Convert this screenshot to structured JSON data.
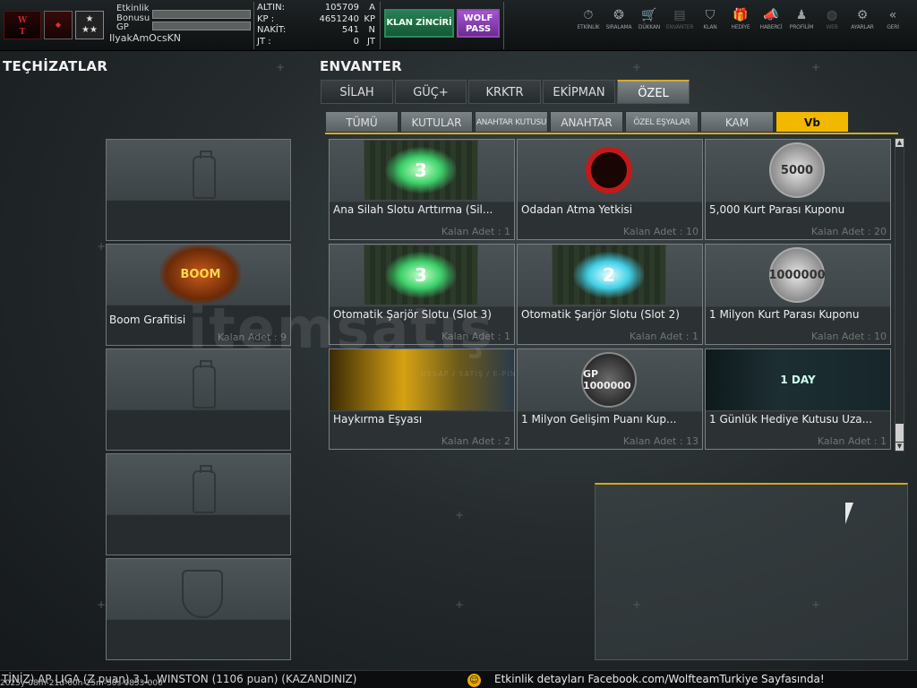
{
  "player": {
    "event_bonus_label": "Etkinlik Bonusu",
    "gp_label": "GP",
    "username": "IlyakAmOcsKN",
    "event_bonus_fraction": 0.0,
    "gp_fraction": 0.0
  },
  "currency": [
    {
      "key": "ALTIN:",
      "value": "105709",
      "unit": "A"
    },
    {
      "key": "KP   :",
      "value": "4651240",
      "unit": "KP"
    },
    {
      "key": "NAKİT:",
      "value": "541",
      "unit": "N"
    },
    {
      "key": "JT   :",
      "value": "0",
      "unit": "JT"
    }
  ],
  "buttons": {
    "clan_chain": "KLAN ZİNCİRİ",
    "wolf_pass": "WOLF PASS"
  },
  "nav": [
    {
      "label": "ETKİNLİK",
      "icon": "stopwatch-icon",
      "glyph": "⏱",
      "enabled": true
    },
    {
      "label": "SIRALAMA",
      "icon": "medal-icon",
      "glyph": "❂",
      "enabled": true
    },
    {
      "label": "DÜKKAN",
      "icon": "cart-icon",
      "glyph": "🛒",
      "enabled": true
    },
    {
      "label": "ENVANTER",
      "icon": "inventory-icon",
      "glyph": "▤",
      "enabled": false
    },
    {
      "label": "KLAN",
      "icon": "clan-shield-icon",
      "glyph": "⛉",
      "enabled": true
    },
    {
      "label": "HEDİYE",
      "icon": "gift-icon",
      "glyph": "🎁",
      "enabled": true
    },
    {
      "label": "HABERCİ",
      "icon": "megaphone-icon",
      "glyph": "📣",
      "enabled": true
    },
    {
      "label": "PROFİLİM",
      "icon": "profile-icon",
      "glyph": "♟",
      "enabled": true
    },
    {
      "label": "WEB",
      "icon": "globe-icon",
      "glyph": "◍",
      "enabled": false
    },
    {
      "label": "AYARLAR",
      "icon": "gear-icon",
      "glyph": "⚙",
      "enabled": true
    },
    {
      "label": "GERİ",
      "icon": "back-chevrons-icon",
      "glyph": "«",
      "enabled": true
    }
  ],
  "equipment": {
    "title": "TEÇHİZATLAR",
    "slots": [
      {
        "name": "",
        "qty": "",
        "type": "spray-can-icon"
      },
      {
        "name": "Boom Grafitisi",
        "qty": "Kalan Adet : 9",
        "type": "boom-graffiti"
      },
      {
        "name": "",
        "qty": "",
        "type": "spray-can-icon"
      },
      {
        "name": "",
        "qty": "",
        "type": "spray-can-icon"
      },
      {
        "name": "",
        "qty": "",
        "type": "shield-icon"
      }
    ],
    "boom_art_text": "BOOM"
  },
  "inventory": {
    "title": "ENVANTER",
    "tabs": [
      {
        "label": "SİLAH",
        "active": false
      },
      {
        "label": "GÜÇ+",
        "active": false
      },
      {
        "label": "KRKTR",
        "active": false
      },
      {
        "label": "EKİPMAN",
        "active": false
      },
      {
        "label": "ÖZEL",
        "active": true
      }
    ],
    "subtabs": [
      {
        "label": "TÜMÜ",
        "active": false
      },
      {
        "label": "KUTULAR",
        "active": false
      },
      {
        "label": "ANAHTAR KUTUSU",
        "active": false
      },
      {
        "label": "ANAHTAR",
        "active": false
      },
      {
        "label": "ÖZEL EŞYALAR",
        "active": false
      },
      {
        "label": "KAM",
        "active": false
      },
      {
        "label": "Vb",
        "active": true
      }
    ],
    "items": [
      {
        "name": "Ana Silah Slotu Arttırma (Sil...",
        "qty": "Kalan Adet : 1",
        "art": "3"
      },
      {
        "name": "Odadan Atma Yetkisi",
        "qty": "Kalan Adet : 10",
        "art": ""
      },
      {
        "name": "5,000 Kurt Parası Kuponu",
        "qty": "Kalan Adet : 20",
        "art": "5000"
      },
      {
        "name": "Otomatik Şarjör Slotu (Slot 3)",
        "qty": "Kalan Adet : 1",
        "art": "3"
      },
      {
        "name": "Otomatik Şarjör Slotu (Slot 2)",
        "qty": "Kalan Adet : 1",
        "art": "2"
      },
      {
        "name": "1 Milyon Kurt Parası Kuponu",
        "qty": "Kalan Adet : 10",
        "art": "1000000"
      },
      {
        "name": "Haykırma Eşyası",
        "qty": "Kalan Adet : 2",
        "art": ""
      },
      {
        "name": "1 Milyon Gelişim Puanı Kup...",
        "qty": "Kalan Adet : 13",
        "art": "GP 1000000"
      },
      {
        "name": "1 Günlük Hediye Kutusu Uza...",
        "qty": "Kalan Adet : 1",
        "art": "1 DAY"
      }
    ]
  },
  "watermark": {
    "text": "itemsatış",
    "subtext": "HESAP / SATIŞ / E-PİN"
  },
  "ticker": {
    "left_text": "TİNİZ) AP LIGA (Z puan) 3.1. WINSTON (1106 puan) (KAZANDINIZ)",
    "timestamp": "2025y-08m-21d-00h-25m-50s-0853-000",
    "right_text": "Etkinlik detayları Facebook.com/WolfteamTurkiye Sayfasında!"
  },
  "colors": {
    "accent_gold": "#f2b800",
    "clan_green": "#2b7e55",
    "wolf_purple": "#a655d4"
  }
}
